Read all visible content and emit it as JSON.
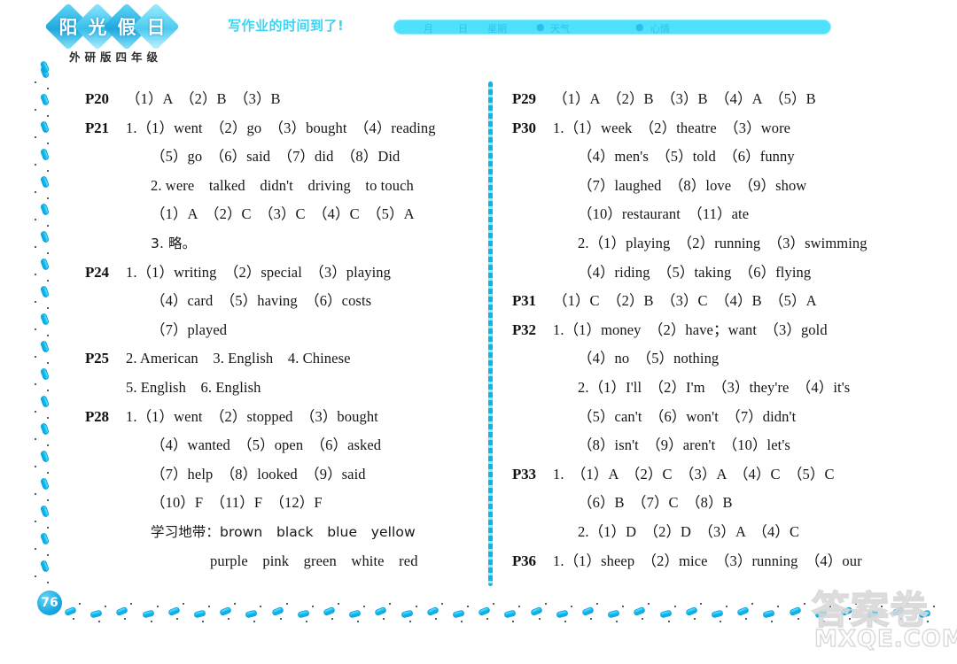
{
  "header": {
    "logo_chars": [
      "阳",
      "光",
      "假",
      "日"
    ],
    "logo_subtitle": "外研版四年级",
    "homework_text": "写作业的时间到了!",
    "date_bar": {
      "month_label": "月",
      "day_label": "日",
      "weekday_label": "星期",
      "weather_dot": "●",
      "weather_label": "天气",
      "mood_dot": "●",
      "mood_label": "心情"
    }
  },
  "colors": {
    "brand_cyan": "#4fe0fb",
    "deep_blue": "#0aa4dd",
    "text_black": "#161616",
    "page_badge": "#1aa9e2"
  },
  "left_column": [
    {
      "page": "P20",
      "lines": [
        {
          "indent": 1,
          "text": "（1）A　（2）B　（3）B"
        }
      ]
    },
    {
      "page": "P21",
      "lines": [
        {
          "indent": 1,
          "text": "1.（1）went　（2）go　（3）bought　（4）reading"
        },
        {
          "indent": 2,
          "text": "（5）go　（6）said　（7）did　（8）Did"
        },
        {
          "indent": 2,
          "text": "2. were　talked　didn't　driving　to touch"
        },
        {
          "indent": 2,
          "text": "（1）A　（2）C　（3）C　（4）C　（5）A"
        },
        {
          "indent": 2,
          "text": "3. 略。",
          "cn": true
        }
      ]
    },
    {
      "page": "P24",
      "lines": [
        {
          "indent": 1,
          "text": "1.（1）writing　（2）special　（3）playing"
        },
        {
          "indent": 2,
          "text": "（4）card　（5）having　（6）costs"
        },
        {
          "indent": 2,
          "text": "（7）played"
        }
      ]
    },
    {
      "page": "P25",
      "lines": [
        {
          "indent": 1,
          "text": "2. American　3. English　4. Chinese"
        },
        {
          "indent": 1,
          "text": "5. English　6. English"
        }
      ]
    },
    {
      "page": "P28",
      "lines": [
        {
          "indent": 1,
          "text": "1.（1）went　（2）stopped　（3）bought"
        },
        {
          "indent": 2,
          "text": "（4）wanted　（5）open　（6）asked"
        },
        {
          "indent": 2,
          "text": "（7）help　（8）looked　（9）said"
        },
        {
          "indent": 2,
          "text": "（10）F　（11）F　（12）F"
        },
        {
          "indent": 2,
          "text": "学习地带：brown　black　blue　yellow",
          "cn": true
        },
        {
          "indent": 4,
          "text": "purple　pink　green　white　red"
        }
      ]
    }
  ],
  "right_column": [
    {
      "page": "P29",
      "lines": [
        {
          "indent": 1,
          "text": "（1）A　（2）B　（3）B　（4）A　（5）B"
        }
      ]
    },
    {
      "page": "P30",
      "lines": [
        {
          "indent": 1,
          "text": "1.（1）week　（2）theatre　（3）wore"
        },
        {
          "indent": 2,
          "text": "（4）men's　（5）told　（6）funny"
        },
        {
          "indent": 2,
          "text": "（7）laughed　（8）love　（9）show"
        },
        {
          "indent": 2,
          "text": "（10）restaurant　（11）ate"
        },
        {
          "indent": 2,
          "text": "2.（1）playing　（2）running　（3）swimming"
        },
        {
          "indent": 2,
          "text": "（4）riding　（5）taking　（6）flying"
        }
      ]
    },
    {
      "page": "P31",
      "lines": [
        {
          "indent": 1,
          "text": "（1）C　（2）B　（3）C　（4）B　（5）A"
        }
      ]
    },
    {
      "page": "P32",
      "lines": [
        {
          "indent": 1,
          "text": "1.（1）money　（2）have；want　（3）gold"
        },
        {
          "indent": 2,
          "text": "（4）no　（5）nothing"
        },
        {
          "indent": 2,
          "text": "2.（1）I'll　（2）I'm　（3）they're　（4）it's"
        },
        {
          "indent": 2,
          "text": "（5）can't　（6）won't　（7）didn't"
        },
        {
          "indent": 2,
          "text": "（8）isn't　（9）aren't　（10）let's"
        }
      ]
    },
    {
      "page": "P33",
      "lines": [
        {
          "indent": 1,
          "text": "1.　（1）A　（2）C　（3）A　（4）C　（5）C"
        },
        {
          "indent": 2,
          "text": "（6）B　（7）C　（8）B"
        },
        {
          "indent": 2,
          "text": "2.（1）D　（2）D　（3）A　（4）C"
        }
      ]
    },
    {
      "page": "P36",
      "lines": [
        {
          "indent": 1,
          "text": "1.（1）sheep　（2）mice　（3）running　（4）our"
        }
      ]
    }
  ],
  "footer": {
    "page_number": "76"
  },
  "watermark": {
    "chinese": "答案卷",
    "site": "MXQE.COM"
  }
}
